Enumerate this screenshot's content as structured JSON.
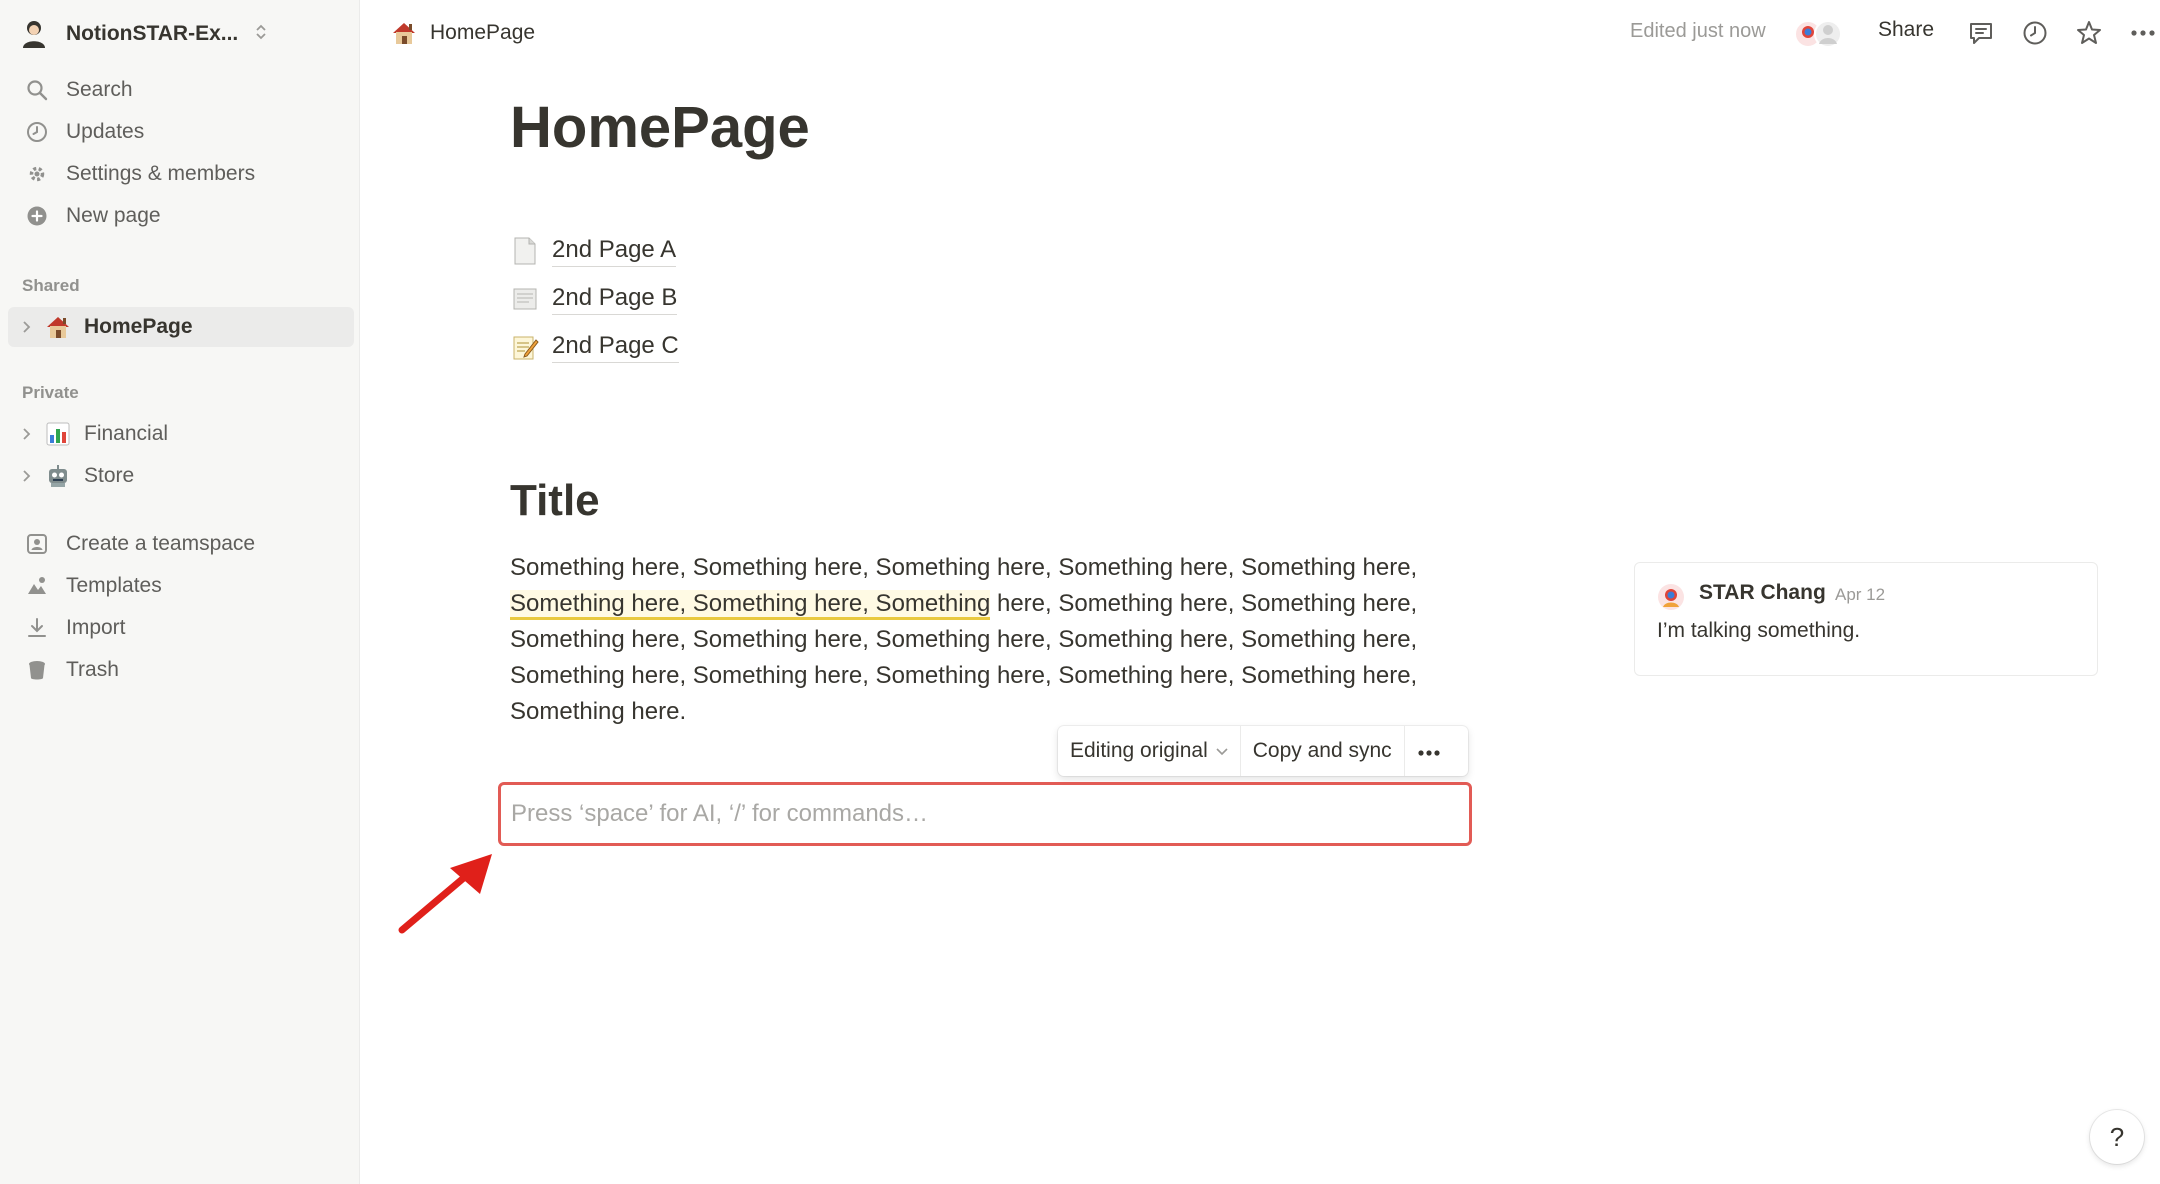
{
  "workspace": {
    "name": "NotionSTAR-Ex...",
    "icon": "person-avatar-icon"
  },
  "sidebar": {
    "nav": [
      {
        "label": "Search",
        "icon": "search-icon"
      },
      {
        "label": "Updates",
        "icon": "clock-icon"
      },
      {
        "label": "Settings & members",
        "icon": "gear-icon"
      },
      {
        "label": "New page",
        "icon": "plus-circle-icon"
      }
    ],
    "shared_label": "Shared",
    "shared": [
      {
        "label": "HomePage",
        "icon": "house-emoji"
      }
    ],
    "private_label": "Private",
    "private": [
      {
        "label": "Financial",
        "icon": "bar-chart-emoji"
      },
      {
        "label": "Store",
        "icon": "robot-emoji"
      }
    ],
    "bottom": [
      {
        "label": "Create a teamspace",
        "icon": "teamspace-icon"
      },
      {
        "label": "Templates",
        "icon": "templates-icon"
      },
      {
        "label": "Import",
        "icon": "download-icon"
      },
      {
        "label": "Trash",
        "icon": "trash-icon"
      }
    ]
  },
  "topbar": {
    "breadcrumb": "HomePage",
    "edited": "Edited just now",
    "share": "Share"
  },
  "page": {
    "title": "HomePage",
    "subpages": [
      {
        "label": "2nd Page A",
        "icon": "page-icon"
      },
      {
        "label": "2nd Page B",
        "icon": "scroll-icon"
      },
      {
        "label": "2nd Page C",
        "icon": "memo-icon"
      }
    ],
    "heading": "Title",
    "paragraph": {
      "part1": "Something here, Something here, Something here, Something here, Something here, ",
      "highlight": "Something here, Something here, Something",
      "part2": " here, Something here, Something here, Something here, Something here, Something here, Something here, Something here, Something here, Something here, Something here, Something here, Something here, Something here."
    },
    "sync_toolbar": {
      "editing": "Editing original",
      "copy": "Copy and sync"
    },
    "input_placeholder": "Press ‘space’ for AI, ‘/’ for commands…"
  },
  "comment": {
    "author": "STAR Chang",
    "date": "Apr 12",
    "text": "I’m talking something."
  },
  "help": "?",
  "colors": {
    "highlight_underline": "#e9c93f",
    "focus_border": "#e25b55",
    "annotation_arrow": "#e0201a"
  }
}
